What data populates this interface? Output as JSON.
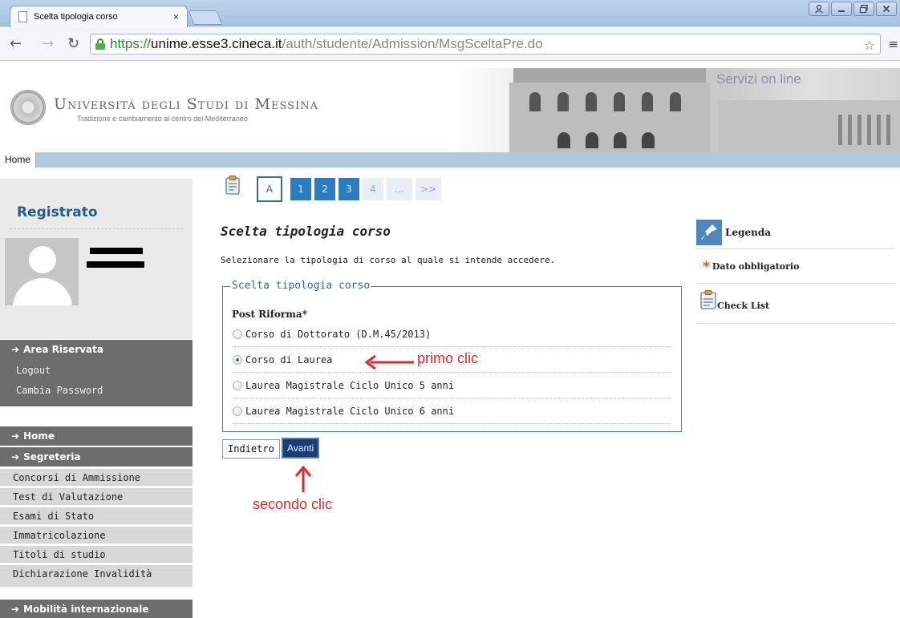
{
  "browser": {
    "tab_title": "Scelta tipologia corso",
    "tab_close": "×",
    "url_scheme": "https://",
    "url_host": "unime.esse3.cineca.it",
    "url_path": "/auth/studente/Admission/MsgSceltaPre.do"
  },
  "header": {
    "university_name": "Università degli Studi di Messina",
    "motto": "Tradizione e cambiamento al centro del Mediterraneo",
    "services": "Servizi on line"
  },
  "nav": {
    "home": "Home"
  },
  "sidebar": {
    "title": "Registrato",
    "area_riservata": {
      "heading": "Area Riservata",
      "links": [
        "Logout",
        "Cambia Password"
      ]
    },
    "home_heading": "Home",
    "segreteria": {
      "heading": "Segreteria",
      "items": [
        "Concorsi di Ammissione",
        "Test di Valutazione",
        "Esami di Stato",
        "Immatricolazione",
        "Titoli di studio",
        "Dichiarazione Invalidità"
      ]
    },
    "mobilita_heading": "Mobilità internazionale"
  },
  "steps": {
    "items": [
      "A",
      "1",
      "2",
      "3",
      "4",
      "...",
      ">>"
    ]
  },
  "main": {
    "title": "Scelta tipologia corso",
    "description": "Selezionare la tipologia di corso al quale si intende accedere.",
    "fieldset_legend": "Scelta tipologia corso",
    "group_label": "Post Riforma*",
    "options": [
      "Corso di Dottorato (D.M.45/2013)",
      "Corso di Laurea",
      "Laurea Magistrale Ciclo Unico 5 anni",
      "Laurea Magistrale Ciclo Unico 6 anni"
    ],
    "selected_option": "Corso di Laurea",
    "back_button": "Indietro",
    "next_button": "Avanti"
  },
  "annotations": {
    "first": "primo clic",
    "second": "secondo clic",
    "color": "#e02a2a"
  },
  "legend_panel": {
    "title": "Legenda",
    "required": "Dato obbligatorio",
    "checklist": "Check List"
  },
  "colors": {
    "accent": "#2f7bbf",
    "sidebar_dark": "#6d6d6d",
    "header_bar": "#b1c9dd",
    "primary_button": "#163f7a"
  }
}
